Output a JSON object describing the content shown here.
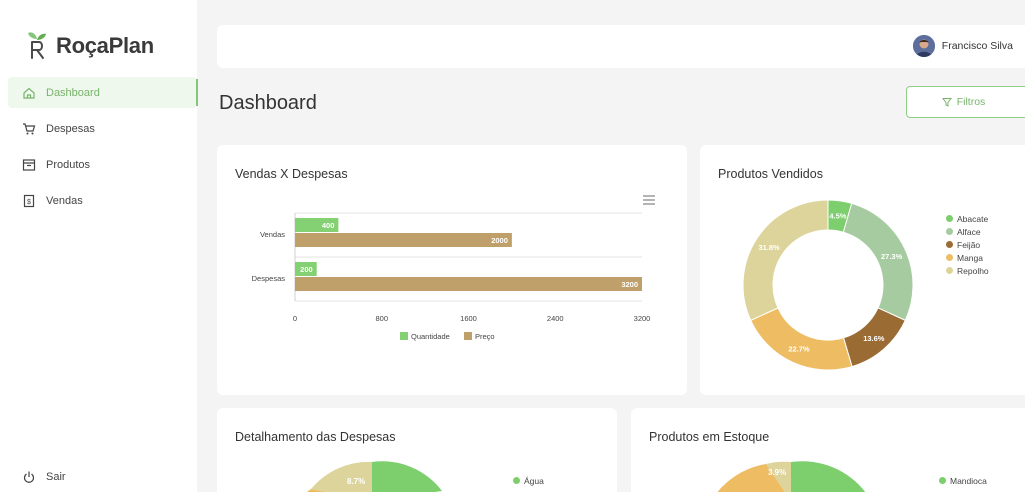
{
  "app": {
    "name": "RoçaPlan"
  },
  "sidebar": {
    "items": [
      {
        "label": "Dashboard",
        "icon": "home-icon",
        "active": true
      },
      {
        "label": "Despesas",
        "icon": "cart-icon",
        "active": false
      },
      {
        "label": "Produtos",
        "icon": "box-icon",
        "active": false
      },
      {
        "label": "Vendas",
        "icon": "receipt-icon",
        "active": false
      }
    ],
    "logout_label": "Sair"
  },
  "header": {
    "user_name": "Francisco Silva"
  },
  "page": {
    "title": "Dashboard",
    "filter_label": "Filtros"
  },
  "colors": {
    "accent": "#85c77a",
    "quantidade": "#84d173",
    "preco": "#bfa06a",
    "abacate": "#7ccf6c",
    "alface": "#a6cba0",
    "feijao": "#9b6b34",
    "manga": "#eebd63",
    "repolho": "#dcd49a"
  },
  "cards": {
    "vendas_despesas": {
      "title": "Vendas X Despesas"
    },
    "produtos_vendidos": {
      "title": "Produtos Vendidos"
    },
    "detalhamento": {
      "title": "Detalhamento das Despesas",
      "legend": [
        "Água"
      ],
      "slice_label": "8.7%"
    },
    "estoque": {
      "title": "Produtos em Estoque",
      "legend": [
        "Mandioca"
      ],
      "slice_label": "3.9%"
    }
  },
  "chart_data": [
    {
      "type": "bar",
      "orientation": "horizontal",
      "categories": [
        "Vendas",
        "Despesas"
      ],
      "series": [
        {
          "name": "Quantidade",
          "values": [
            400,
            200
          ]
        },
        {
          "name": "Preço",
          "values": [
            2000,
            3200
          ]
        }
      ],
      "xticks": [
        "0",
        "800",
        "1600",
        "2400",
        "3200"
      ],
      "xlim": [
        0,
        3200
      ],
      "legend": "bottom"
    },
    {
      "type": "pie",
      "donut": true,
      "labels": [
        "Abacate",
        "Alface",
        "Feijão",
        "Manga",
        "Repolho"
      ],
      "values": [
        4.5,
        27.3,
        13.6,
        22.7,
        31.8
      ],
      "display_labels": [
        "4.5%",
        "27.3%",
        "13.6%",
        "22.7%",
        "31.8%"
      ],
      "legend": "right"
    }
  ]
}
